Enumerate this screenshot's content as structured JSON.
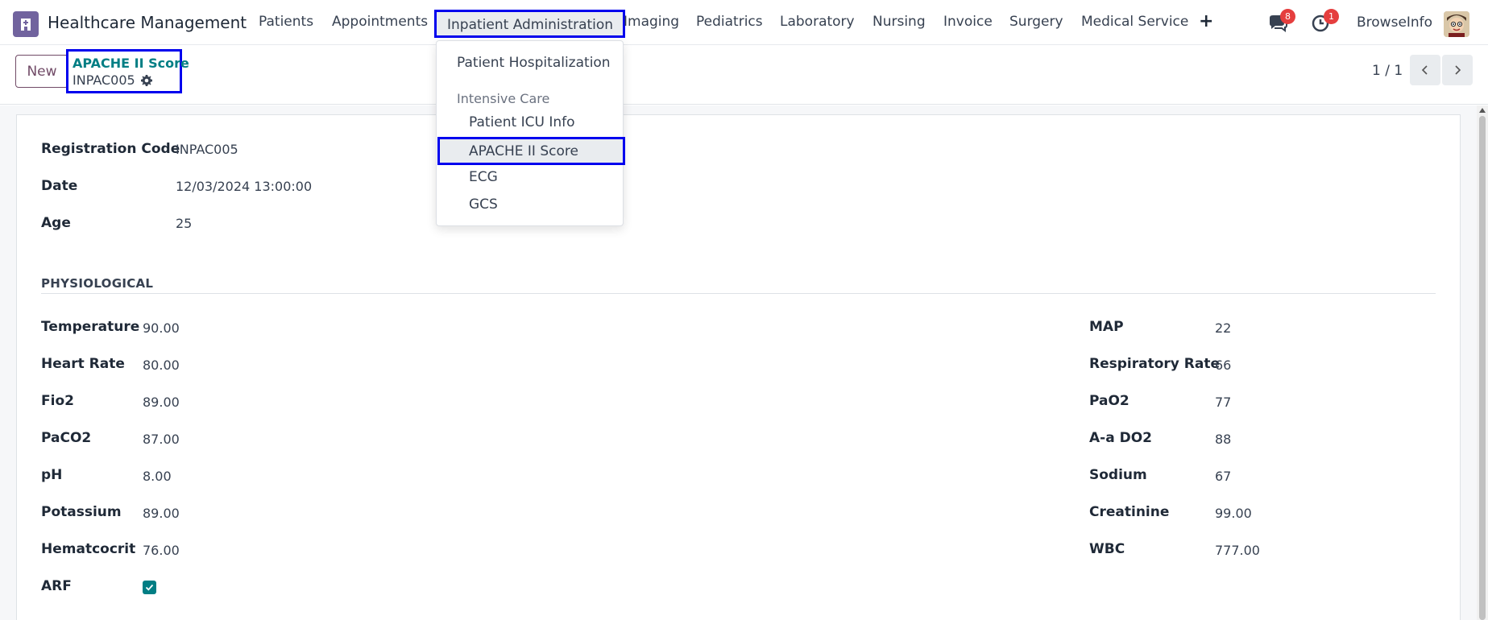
{
  "app": {
    "title": "Healthcare Management",
    "logo_icon": "hospital-icon",
    "brand_color": "#71639e"
  },
  "menu": {
    "items": [
      {
        "label": "Patients"
      },
      {
        "label": "Appointments"
      },
      {
        "label": "Inpatient Administration",
        "active": true
      },
      {
        "label": "Imaging"
      },
      {
        "label": "Pediatrics"
      },
      {
        "label": "Laboratory"
      },
      {
        "label": "Nursing"
      },
      {
        "label": "Invoice"
      },
      {
        "label": "Surgery"
      },
      {
        "label": "Medical Service"
      }
    ],
    "plus": "+"
  },
  "systray": {
    "messages_badge": "8",
    "activities_badge": "1",
    "username": "BrowseInfo"
  },
  "dropdown": {
    "hospitalization": "Patient Hospitalization",
    "section_header": "Intensive Care",
    "icu_info": "Patient ICU Info",
    "apache": "APACHE II Score",
    "ecg": "ECG",
    "gcs": "GCS"
  },
  "control": {
    "new_label": "New",
    "breadcrumb_parent": "APACHE II Score",
    "record_name": "INPAC005",
    "pager": "1 / 1"
  },
  "form": {
    "registration_code": {
      "label": "Registration Code",
      "value": "INPAC005"
    },
    "date": {
      "label": "Date",
      "value": "12/03/2024 13:00:00"
    },
    "age": {
      "label": "Age",
      "value": "25"
    },
    "section": "PHYSIOLOGICAL",
    "left": [
      {
        "label": "Temperature",
        "value": "90.00"
      },
      {
        "label": "Heart Rate",
        "value": "80.00"
      },
      {
        "label": "Fio2",
        "value": "89.00"
      },
      {
        "label": "PaCO2",
        "value": "87.00"
      },
      {
        "label": "pH",
        "value": "8.00"
      },
      {
        "label": "Potassium",
        "value": "89.00"
      },
      {
        "label": "Hematcocrit",
        "value": "76.00"
      }
    ],
    "arf": {
      "label": "ARF",
      "checked": true
    },
    "right": [
      {
        "label": "MAP",
        "value": "22"
      },
      {
        "label": "Respiratory Rate",
        "value": "66"
      },
      {
        "label": "PaO2",
        "value": "77"
      },
      {
        "label": "A-a DO2",
        "value": "88"
      },
      {
        "label": "Sodium",
        "value": "67"
      },
      {
        "label": "Creatinine",
        "value": "99.00"
      },
      {
        "label": "WBC",
        "value": "777.00"
      }
    ]
  },
  "colors": {
    "accent": "#017e84",
    "primary": "#714b67",
    "highlight_border": "#0000ee"
  }
}
